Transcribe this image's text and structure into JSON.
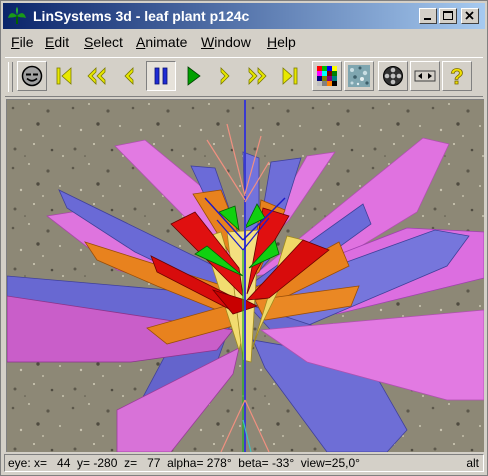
{
  "window": {
    "title": "LinSystems 3d - leaf plant p124c"
  },
  "menu": [
    {
      "label_underlined": "F",
      "label_rest": "ile"
    },
    {
      "label_underlined": "E",
      "label_rest": "dit"
    },
    {
      "label_underlined": "S",
      "label_rest": "elect"
    },
    {
      "label_underlined": "A",
      "label_rest": "nimate"
    },
    {
      "label_underlined": "W",
      "label_rest": "indow"
    },
    {
      "label_underlined": "H",
      "label_rest": "elp"
    }
  ],
  "toolbar": {
    "icons": [
      "smiley-icon",
      "first-frame-icon",
      "rewind-icon",
      "step-back-icon",
      "pause-icon",
      "play-icon",
      "step-forward-icon",
      "fast-forward-icon",
      "last-frame-icon",
      "color-palette-icon",
      "texture-icon",
      "film-reel-icon",
      "size-toggle-icon",
      "help-icon"
    ],
    "active": "pause-icon",
    "colors": {
      "nav": "#e8e800",
      "pause": "#1e2bd4",
      "play": "#00a000",
      "help": "#f0e000"
    }
  },
  "status": {
    "text": "eye: x=   44  y= -280  z=   77  alpha= 278°  beta= -33°  view=25,0°",
    "mode": "alt"
  },
  "colors": {
    "titlebar_start": "#0a246a",
    "titlebar_end": "#a6caf0",
    "leaf_magenta": "#e070e0",
    "leaf_blue": "#6b6bd8",
    "leaf_orange": "#e8821e",
    "leaf_red": "#e01010",
    "leaf_yellow": "#f2dc70",
    "leaf_green": "#10d010"
  }
}
